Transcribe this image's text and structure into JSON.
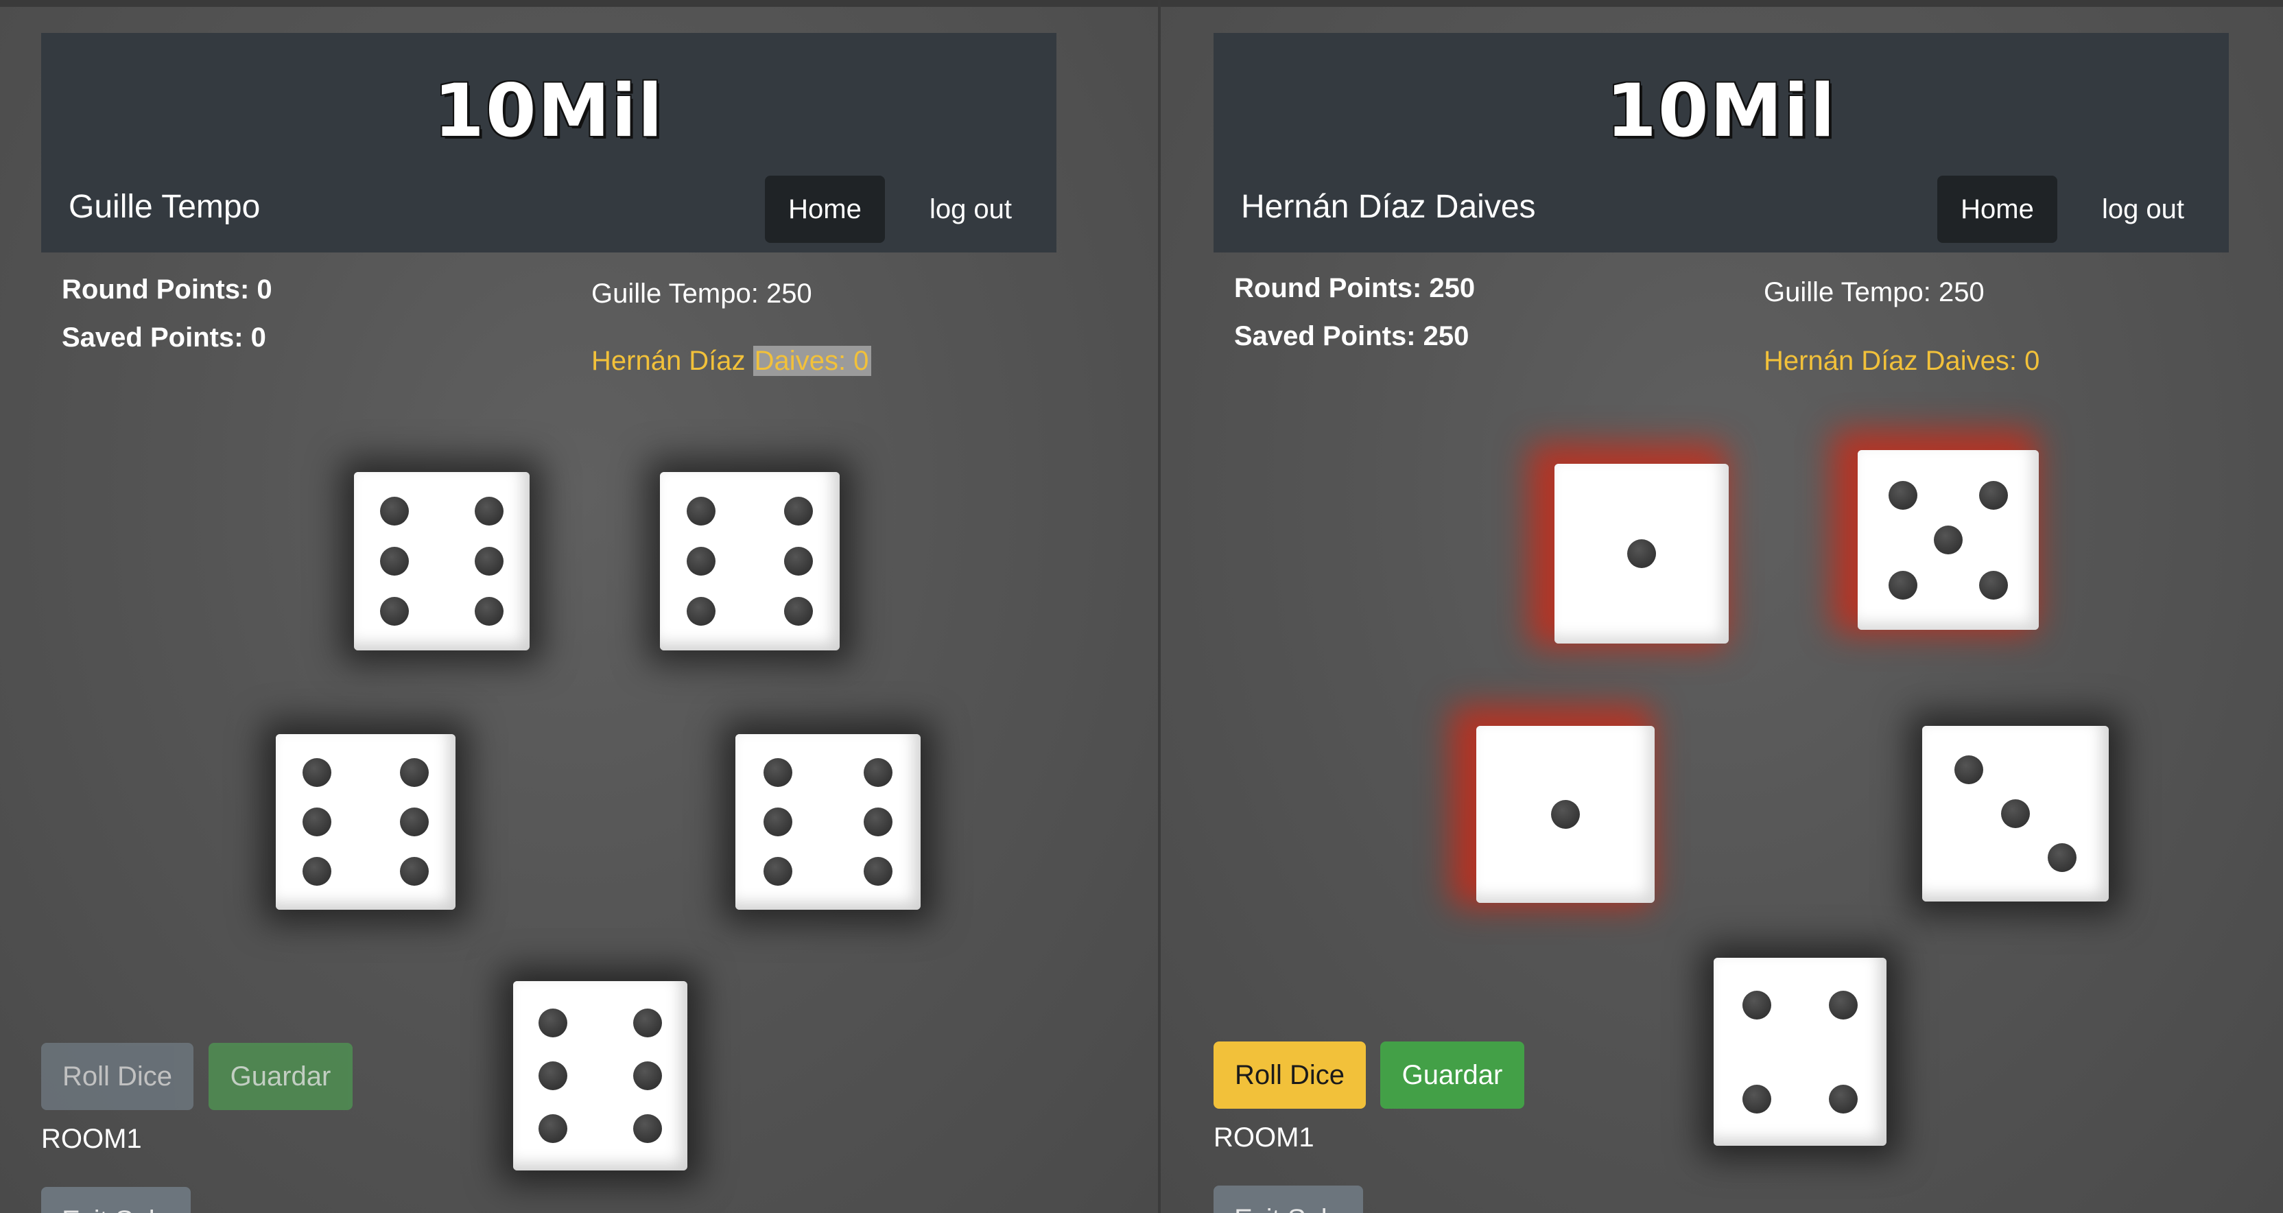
{
  "logo_text": "10Mil",
  "left_panel": {
    "user_name": "Guille Tempo",
    "nav": {
      "home": "Home",
      "logout": "log out"
    },
    "round_points": "Round Points: 0",
    "saved_points": "Saved Points: 0",
    "scores": [
      {
        "text": "Guille Tempo: 250",
        "active": false
      },
      {
        "text_before_selection": "Hernán Díaz ",
        "text_selected": "Daives: 0",
        "active": true
      }
    ],
    "dice_values": [
      6,
      6,
      6,
      6,
      6
    ],
    "buttons": {
      "roll": "Roll Dice",
      "save": "Guardar",
      "exit": "Exit Sala"
    },
    "room": "ROOM1"
  },
  "right_panel": {
    "user_name": "Hernán Díaz Daives",
    "nav": {
      "home": "Home",
      "logout": "log out"
    },
    "round_points": "Round Points: 250",
    "saved_points": "Saved Points: 250",
    "scores": [
      {
        "text": "Guille Tempo: 250",
        "active": false
      },
      {
        "text": "Hernán Díaz Daives: 0",
        "active": true
      }
    ],
    "dice": [
      {
        "value": 1,
        "held": true
      },
      {
        "value": 5,
        "held": true
      },
      {
        "value": 1,
        "held": true
      },
      {
        "value": 3,
        "held": false
      },
      {
        "value": 4,
        "held": false
      }
    ],
    "buttons": {
      "roll": "Roll Dice",
      "save": "Guardar",
      "exit": "Exit Sala"
    },
    "room": "ROOM1"
  },
  "colors": {
    "navbar": "#343a40",
    "active_player": "#f2c13a",
    "held_glow": "#d22814",
    "roll_button": "#f2c13a",
    "save_button": "#43a047"
  }
}
